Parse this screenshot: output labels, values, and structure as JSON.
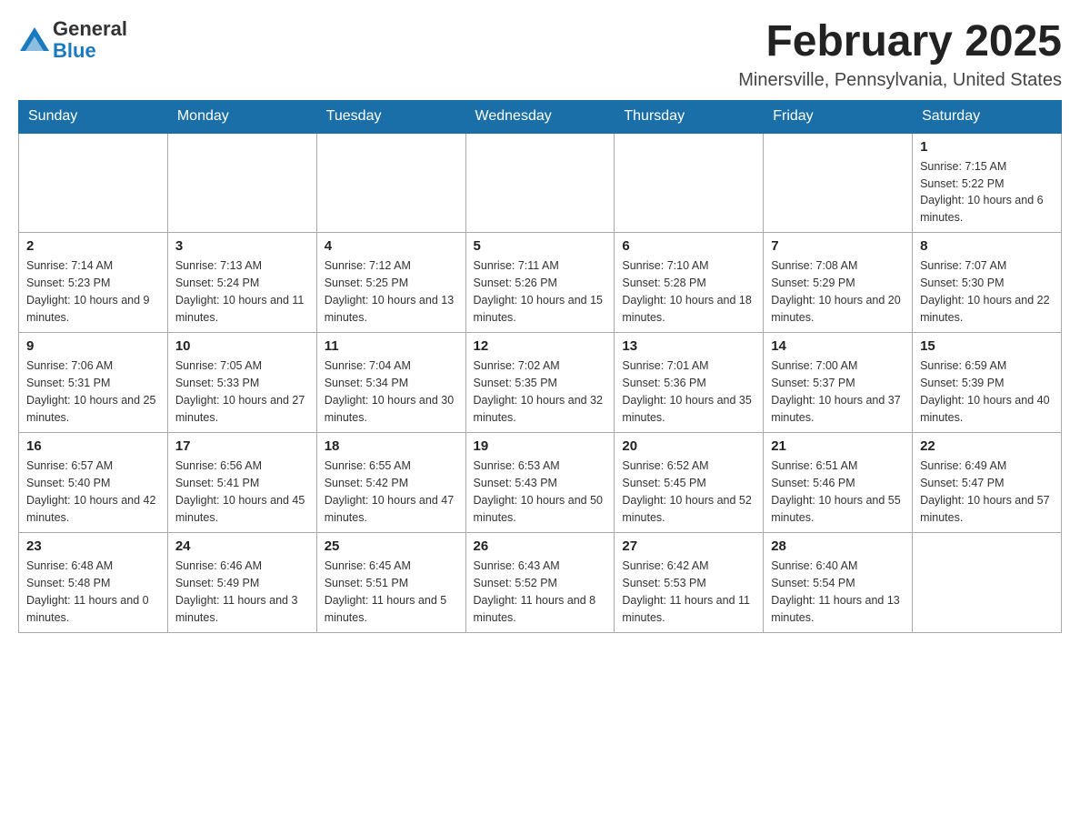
{
  "header": {
    "logo": {
      "text_general": "General",
      "text_blue": "Blue"
    },
    "title": "February 2025",
    "location": "Minersville, Pennsylvania, United States"
  },
  "weekdays": [
    "Sunday",
    "Monday",
    "Tuesday",
    "Wednesday",
    "Thursday",
    "Friday",
    "Saturday"
  ],
  "weeks": [
    [
      {
        "day": "",
        "sunrise": "",
        "sunset": "",
        "daylight": ""
      },
      {
        "day": "",
        "sunrise": "",
        "sunset": "",
        "daylight": ""
      },
      {
        "day": "",
        "sunrise": "",
        "sunset": "",
        "daylight": ""
      },
      {
        "day": "",
        "sunrise": "",
        "sunset": "",
        "daylight": ""
      },
      {
        "day": "",
        "sunrise": "",
        "sunset": "",
        "daylight": ""
      },
      {
        "day": "",
        "sunrise": "",
        "sunset": "",
        "daylight": ""
      },
      {
        "day": "1",
        "sunrise": "Sunrise: 7:15 AM",
        "sunset": "Sunset: 5:22 PM",
        "daylight": "Daylight: 10 hours and 6 minutes."
      }
    ],
    [
      {
        "day": "2",
        "sunrise": "Sunrise: 7:14 AM",
        "sunset": "Sunset: 5:23 PM",
        "daylight": "Daylight: 10 hours and 9 minutes."
      },
      {
        "day": "3",
        "sunrise": "Sunrise: 7:13 AM",
        "sunset": "Sunset: 5:24 PM",
        "daylight": "Daylight: 10 hours and 11 minutes."
      },
      {
        "day": "4",
        "sunrise": "Sunrise: 7:12 AM",
        "sunset": "Sunset: 5:25 PM",
        "daylight": "Daylight: 10 hours and 13 minutes."
      },
      {
        "day": "5",
        "sunrise": "Sunrise: 7:11 AM",
        "sunset": "Sunset: 5:26 PM",
        "daylight": "Daylight: 10 hours and 15 minutes."
      },
      {
        "day": "6",
        "sunrise": "Sunrise: 7:10 AM",
        "sunset": "Sunset: 5:28 PM",
        "daylight": "Daylight: 10 hours and 18 minutes."
      },
      {
        "day": "7",
        "sunrise": "Sunrise: 7:08 AM",
        "sunset": "Sunset: 5:29 PM",
        "daylight": "Daylight: 10 hours and 20 minutes."
      },
      {
        "day": "8",
        "sunrise": "Sunrise: 7:07 AM",
        "sunset": "Sunset: 5:30 PM",
        "daylight": "Daylight: 10 hours and 22 minutes."
      }
    ],
    [
      {
        "day": "9",
        "sunrise": "Sunrise: 7:06 AM",
        "sunset": "Sunset: 5:31 PM",
        "daylight": "Daylight: 10 hours and 25 minutes."
      },
      {
        "day": "10",
        "sunrise": "Sunrise: 7:05 AM",
        "sunset": "Sunset: 5:33 PM",
        "daylight": "Daylight: 10 hours and 27 minutes."
      },
      {
        "day": "11",
        "sunrise": "Sunrise: 7:04 AM",
        "sunset": "Sunset: 5:34 PM",
        "daylight": "Daylight: 10 hours and 30 minutes."
      },
      {
        "day": "12",
        "sunrise": "Sunrise: 7:02 AM",
        "sunset": "Sunset: 5:35 PM",
        "daylight": "Daylight: 10 hours and 32 minutes."
      },
      {
        "day": "13",
        "sunrise": "Sunrise: 7:01 AM",
        "sunset": "Sunset: 5:36 PM",
        "daylight": "Daylight: 10 hours and 35 minutes."
      },
      {
        "day": "14",
        "sunrise": "Sunrise: 7:00 AM",
        "sunset": "Sunset: 5:37 PM",
        "daylight": "Daylight: 10 hours and 37 minutes."
      },
      {
        "day": "15",
        "sunrise": "Sunrise: 6:59 AM",
        "sunset": "Sunset: 5:39 PM",
        "daylight": "Daylight: 10 hours and 40 minutes."
      }
    ],
    [
      {
        "day": "16",
        "sunrise": "Sunrise: 6:57 AM",
        "sunset": "Sunset: 5:40 PM",
        "daylight": "Daylight: 10 hours and 42 minutes."
      },
      {
        "day": "17",
        "sunrise": "Sunrise: 6:56 AM",
        "sunset": "Sunset: 5:41 PM",
        "daylight": "Daylight: 10 hours and 45 minutes."
      },
      {
        "day": "18",
        "sunrise": "Sunrise: 6:55 AM",
        "sunset": "Sunset: 5:42 PM",
        "daylight": "Daylight: 10 hours and 47 minutes."
      },
      {
        "day": "19",
        "sunrise": "Sunrise: 6:53 AM",
        "sunset": "Sunset: 5:43 PM",
        "daylight": "Daylight: 10 hours and 50 minutes."
      },
      {
        "day": "20",
        "sunrise": "Sunrise: 6:52 AM",
        "sunset": "Sunset: 5:45 PM",
        "daylight": "Daylight: 10 hours and 52 minutes."
      },
      {
        "day": "21",
        "sunrise": "Sunrise: 6:51 AM",
        "sunset": "Sunset: 5:46 PM",
        "daylight": "Daylight: 10 hours and 55 minutes."
      },
      {
        "day": "22",
        "sunrise": "Sunrise: 6:49 AM",
        "sunset": "Sunset: 5:47 PM",
        "daylight": "Daylight: 10 hours and 57 minutes."
      }
    ],
    [
      {
        "day": "23",
        "sunrise": "Sunrise: 6:48 AM",
        "sunset": "Sunset: 5:48 PM",
        "daylight": "Daylight: 11 hours and 0 minutes."
      },
      {
        "day": "24",
        "sunrise": "Sunrise: 6:46 AM",
        "sunset": "Sunset: 5:49 PM",
        "daylight": "Daylight: 11 hours and 3 minutes."
      },
      {
        "day": "25",
        "sunrise": "Sunrise: 6:45 AM",
        "sunset": "Sunset: 5:51 PM",
        "daylight": "Daylight: 11 hours and 5 minutes."
      },
      {
        "day": "26",
        "sunrise": "Sunrise: 6:43 AM",
        "sunset": "Sunset: 5:52 PM",
        "daylight": "Daylight: 11 hours and 8 minutes."
      },
      {
        "day": "27",
        "sunrise": "Sunrise: 6:42 AM",
        "sunset": "Sunset: 5:53 PM",
        "daylight": "Daylight: 11 hours and 11 minutes."
      },
      {
        "day": "28",
        "sunrise": "Sunrise: 6:40 AM",
        "sunset": "Sunset: 5:54 PM",
        "daylight": "Daylight: 11 hours and 13 minutes."
      },
      {
        "day": "",
        "sunrise": "",
        "sunset": "",
        "daylight": ""
      }
    ]
  ]
}
